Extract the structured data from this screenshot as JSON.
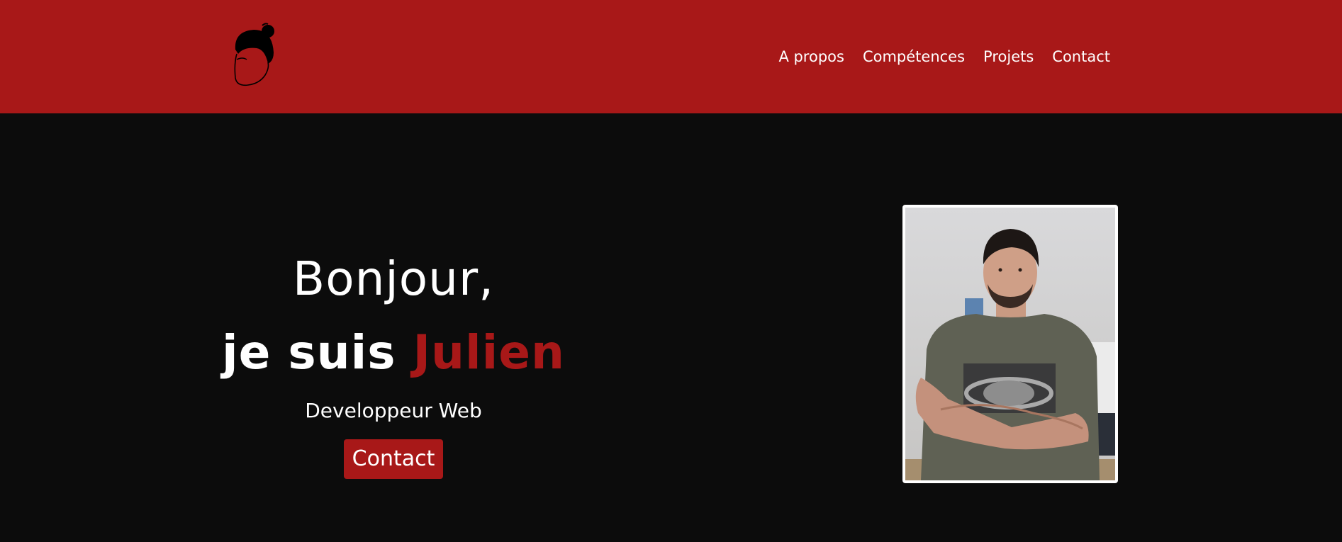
{
  "nav": {
    "items": [
      {
        "label": "A propos"
      },
      {
        "label": "Compétences"
      },
      {
        "label": "Projets"
      },
      {
        "label": "Contact"
      }
    ]
  },
  "hero": {
    "greeting": "Bonjour,",
    "intro": "je suis ",
    "name": "Julien",
    "role": "Developpeur Web",
    "button_label": "Contact"
  },
  "colors": {
    "accent": "#a81818",
    "background": "#0c0c0c",
    "text": "#ffffff"
  },
  "icons": {
    "logo": "avatar-bun-logo-icon"
  }
}
